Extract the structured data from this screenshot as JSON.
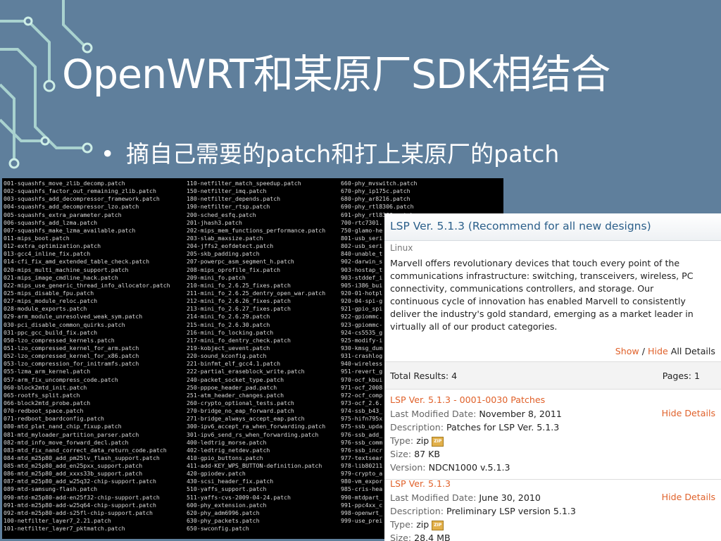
{
  "slide": {
    "title": "OpenWRT和某原厂SDK相结合",
    "bullet": "•",
    "bullet_text": "摘自己需要的patch和打上某原厂的patch"
  },
  "terminal": {
    "col1": [
      "001-squashfs_move_zlib_decomp.patch",
      "002-squashfs_factor_out_remaining_zlib.patch",
      "003-squashfs_add_decompressor_framework.patch",
      "004-squashfs_add_decompressor_lzo.patch",
      "005-squashfs_extra_parameter.patch",
      "006-squashfs_add_lzma.patch",
      "007-squashfs_make_lzma_available.patch",
      "011-mips_boot.patch",
      "012-extra_optimization.patch",
      "013-gcc4_inline_fix.patch",
      "014-cfi_fix_amd_extended_table_check.patch",
      "020-mips_multi_machine_support.patch",
      "021-mips_image_cmdline_hack.patch",
      "022-mips_use_generic_thread_info_allocator.patch",
      "025-mips_disable_fpu.patch",
      "027-mips_module_reloc.patch",
      "028-module_exports.patch",
      "029-arm_module_unresolved_weak_sym.patch",
      "030-pci_disable_common_quirks.patch",
      "031-ppc_gcc_build_fix.patch",
      "050-lzo_compressed_kernels.patch",
      "051-lzo_compressed_kernel_for_arm.patch",
      "052-lzo_compressed_kernel_for_x86.patch",
      "053-lzo_compression_for_initramfs.patch",
      "055-lzma_arm_kernel.patch",
      "057-arm_fix_uncompress_code.patch",
      "060-block2mtd_init.patch",
      "065-rootfs_split.patch",
      "066-block2mtd_probe.patch",
      "070-redboot_space.patch",
      "071-redboot_boardconfig.patch",
      "080-mtd_plat_nand_chip_fixup.patch",
      "081-mtd_myloader_partition_parser.patch",
      "082-mtd_info_move_forward_decl.patch",
      "083-mtd_fix_nand_correct_data_return_code.patch",
      "084-mtd_m25p80_add_pm25lv_flash_support.patch",
      "085-mtd_m25p80_add_en25pxx_support.patch",
      "086-mtd_m25p80_add_xxxs33b_support.patch",
      "087-mtd_m25p80_add_w25q32-chip-support.patch",
      "089-mtd-samsung-flash.patch",
      "090-mtd-m25p80-add-en25f32-chip-support.patch",
      "091-mtd-m25p80-add-w25q64-chip-support.patch",
      "092-mtd-m25p80-add-s25fl-chip-support.patch",
      "100-netfilter_layer7_2.21.patch",
      "101-netfilter_layer7_pktmatch.patch"
    ],
    "col2": [
      "110-netfilter_match_speedup.patch",
      "150-netfilter_imq.patch",
      "180-netfilter_depends.patch",
      "190-netfilter_rtsp.patch",
      "200-sched_esfq.patch",
      "201-jhash3.patch",
      "202-mips_mem_functions_performance.patch",
      "203-slab_maxsize.patch",
      "204-jffs2_eofdetect.patch",
      "205-skb_padding.patch",
      "207-powerpc_asm_segment_h.patch",
      "208-mips_oprofile_fix.patch",
      "209-mini_fo.patch",
      "210-mini_fo_2.6.25_fixes.patch",
      "211-mini_fo_2.6.25_dentry_open_war.patch",
      "212-mini_fo_2.6.26_fixes.patch",
      "213-mini_fo_2.6.27_fixes.patch",
      "214-mini_fo_2.6.29.patch",
      "215-mini_fo_2.6.30.patch",
      "216-mini_fo_locking.patch",
      "217-mini_fo_dentry_check.patch",
      "219-kobject_uevent.patch",
      "220-sound_kconfig.patch",
      "221-binfmt_elf_gcc4.1.patch",
      "222-partial_eraseblock_write.patch",
      "240-packet_socket_type.patch",
      "250-pppoe_header_pad.patch",
      "251-atm_header_changes.patch",
      "260-crypto_optional_tests.patch",
      "270-bridge_no_eap_forward.patch",
      "271-bridge_always_accept_eap.patch",
      "300-ipv6_accept_ra_when_forwarding.patch",
      "301-ipv6_send_rs_when_forwarding.patch",
      "400-ledtrig_morse.patch",
      "402-ledtrig_netdev.patch",
      "410-gpio_buttons.patch",
      "411-add-KEY_WPS_BUTTON-definition.patch",
      "420-gpiodev.patch",
      "430-scsi_header_fix.patch",
      "510-yaffs_support.patch",
      "511-yaffs-cvs-2009-04-24.patch",
      "600-phy_extension.patch",
      "620-phy_adm6996.patch",
      "630-phy_packets.patch",
      "650-swconfig.patch"
    ],
    "col3": [
      "660-phy_mvswitch.patch",
      "670-phy_ip175c.patch",
      "680-phy_ar8216.patch",
      "690-phy_rtl8306.patch",
      "691-phy_rtl8366.patch",
      "700-rtc7301.",
      "750-glamo-he",
      "801-usb_seri",
      "802-usb_seri",
      "840-unable_t",
      "902-darwin_s",
      "903-hostap_t",
      "903-stddef_i",
      "905-i386_bui",
      "920-01-hotpl",
      "920-04-spi-g",
      "921-gpio_spi",
      "922-gpiommc.",
      "923-gpiommc-",
      "924-cs5535_g",
      "925-modify-i",
      "930-kmsg_dum",
      "931-crashlog",
      "940-wireless",
      "951-revert_g",
      "970-ocf_kbui",
      "971-ocf_2008",
      "972-ocf_comp",
      "973-ocf_2.6.",
      "974-ssb_b43_",
      "975-hifn795x",
      "975-ssb_upda",
      "976-ssb_add_",
      "976-ssb_comm",
      "976-ssb_incr",
      "977-textsear",
      "978-lib80211",
      "979-crypto_a",
      "980-vm_expor",
      "985-cris-hea",
      "990-mtdpart_",
      "991-ppc4xx_c",
      "998-openwrt_",
      "999-use_prei"
    ]
  },
  "web": {
    "lsp_title": "LSP Ver. 5.1.3 (Recommend for all new designs)",
    "category": "Linux",
    "description": "Marvell offers revolutionary devices that touch every point of the communications infrastructure: switching, transceivers, wireless, PC connectivity, communications controllers, and storage. Our continuous cycle of innovation has enabled Marvell to consistently deliver the industry's gold standard, emerging as a market leader in virtually all of our product categories.",
    "show": "Show",
    "sep": "/",
    "hide": "Hide",
    "all_details": "All Details",
    "total_results": "Total Results: 4",
    "pages": "Pages: 1",
    "entries": [
      {
        "title": "LSP Ver. 5.1.3 - 0001-0030 Patches",
        "hide_details": "Hide Details",
        "date_label": "Last Modified Date:",
        "date": "November 8, 2011",
        "desc_label": "Description:",
        "desc": "Patches for LSP Ver. 5.1.3",
        "type_label": "Type:",
        "type": "zip",
        "zip_icon": "ZIP",
        "size_label": "Size:",
        "size": "87 KB",
        "version_label": "Version:",
        "version": "NDCN1000 v.5.1.3"
      },
      {
        "title": "LSP Ver. 5.1.3",
        "hide_details": "Hide Details",
        "date_label": "Last Modified Date:",
        "date": "June 30, 2010",
        "desc_label": "Description:",
        "desc": "Preliminary LSP version 5.1.3",
        "type_label": "Type:",
        "type": "zip",
        "zip_icon": "ZIP",
        "size_label": "Size:",
        "size": "28.4 MB"
      }
    ]
  }
}
